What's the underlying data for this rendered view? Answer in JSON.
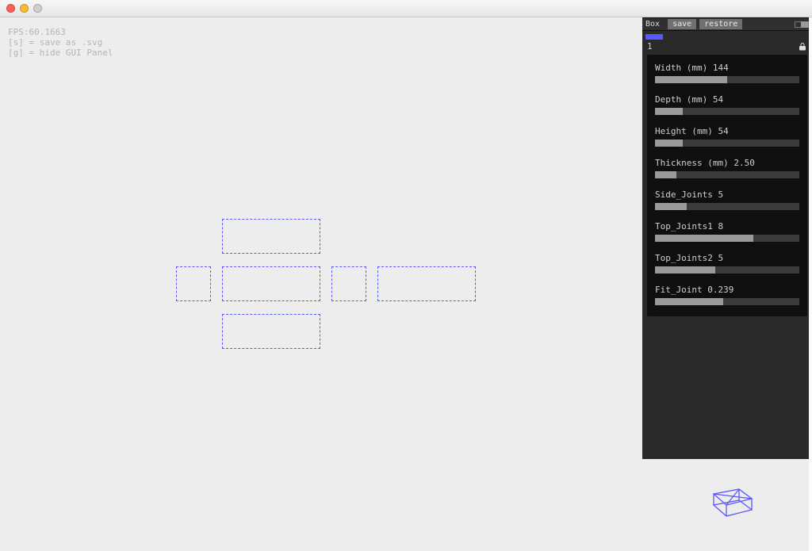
{
  "overlay": {
    "fps_label": "FPS:",
    "fps_value": "60.1663",
    "hint_save": "[s] = save as .svg",
    "hint_gui": "[g] = hide GUI Panel"
  },
  "panel": {
    "title": "Box",
    "save_label": "save",
    "restore_label": "restore",
    "section_id": "1"
  },
  "params": [
    {
      "label": "Width (mm)",
      "value": "144",
      "fill": 50
    },
    {
      "label": "Depth (mm)",
      "value": "54",
      "fill": 19
    },
    {
      "label": "Height (mm)",
      "value": "54",
      "fill": 19
    },
    {
      "label": "Thickness (mm)",
      "value": "2.50",
      "fill": 15
    },
    {
      "label": "Side_Joints",
      "value": "5",
      "fill": 22
    },
    {
      "label": "Top_Joints1",
      "value": "8",
      "fill": 68
    },
    {
      "label": "Top_Joints2",
      "value": "5",
      "fill": 42
    },
    {
      "label": "Fit_Joint",
      "value": "0.239",
      "fill": 47
    }
  ]
}
